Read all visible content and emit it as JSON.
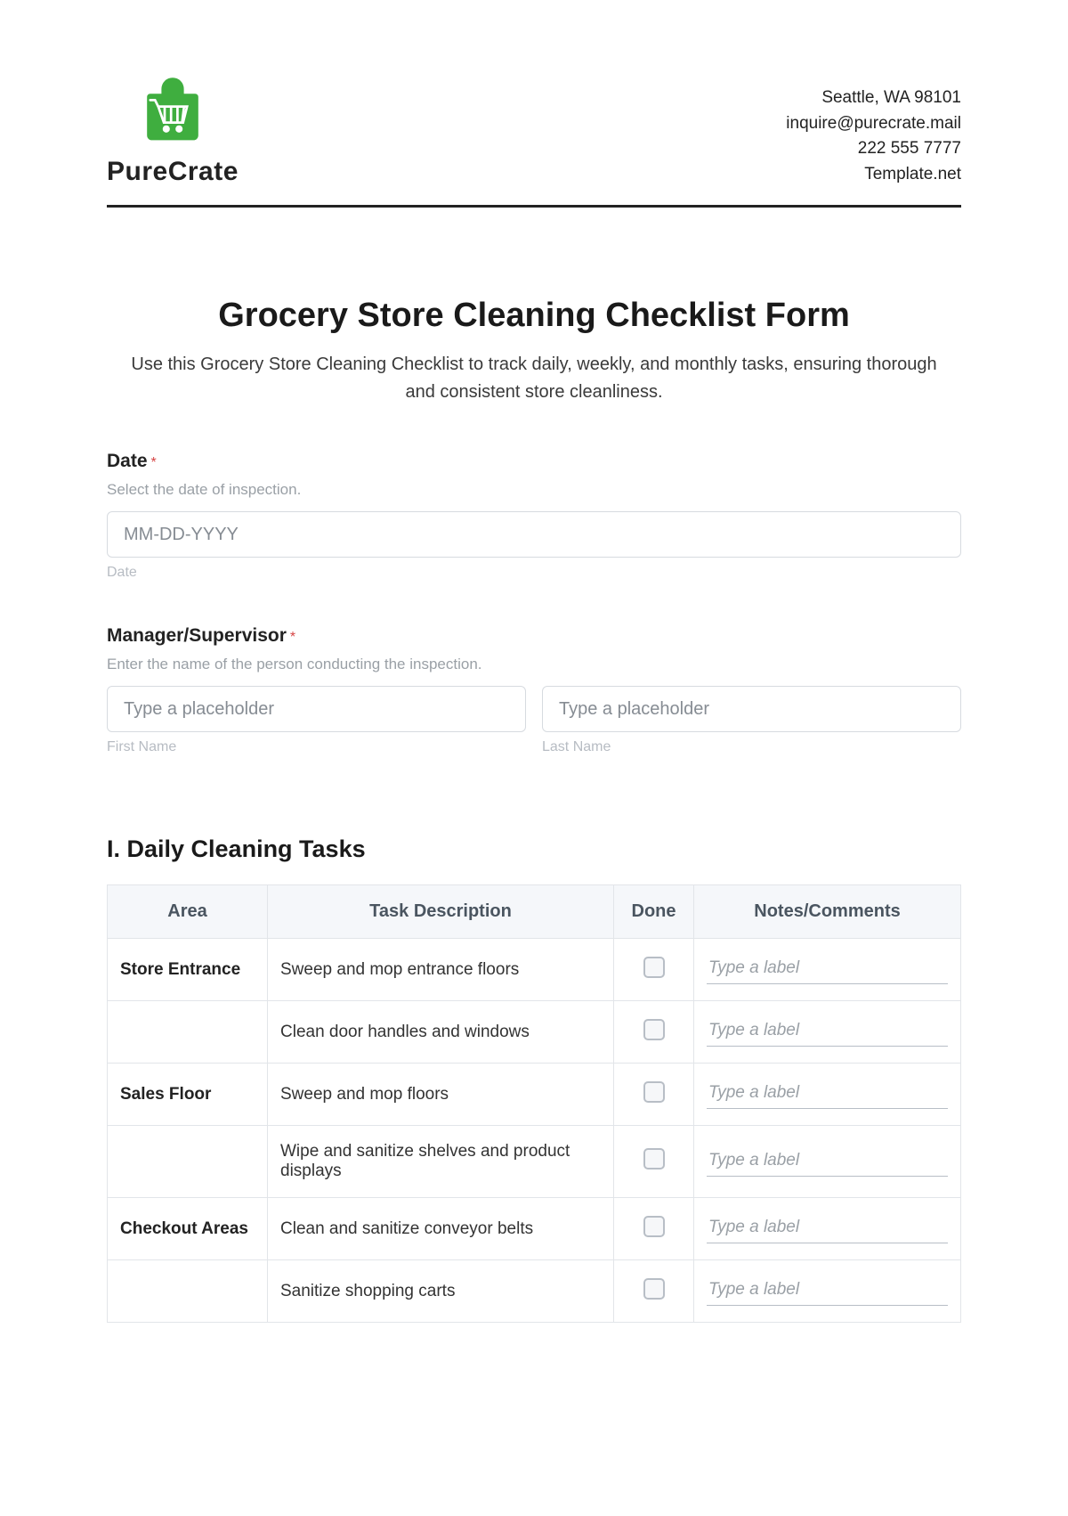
{
  "brand": {
    "name": "PureCrate"
  },
  "contact": {
    "line1": "Seattle, WA 98101",
    "line2": "inquire@purecrate.mail",
    "line3": "222 555 7777",
    "line4": "Template.net"
  },
  "title": "Grocery Store Cleaning Checklist Form",
  "subtitle": "Use this Grocery Store Cleaning Checklist to track daily, weekly, and monthly tasks, ensuring thorough and consistent store cleanliness.",
  "fields": {
    "date": {
      "label": "Date",
      "help": "Select the date of inspection.",
      "placeholder": "MM-DD-YYYY",
      "under": "Date"
    },
    "manager": {
      "label": "Manager/Supervisor",
      "help": "Enter the name of the person conducting the inspection.",
      "first_placeholder": "Type a placeholder",
      "last_placeholder": "Type a placeholder",
      "first_under": "First Name",
      "last_under": "Last Name"
    }
  },
  "section1": {
    "heading": "I. Daily Cleaning Tasks",
    "columns": {
      "area": "Area",
      "task": "Task Description",
      "done": "Done",
      "notes": "Notes/Comments"
    },
    "note_placeholder": "Type a label",
    "rows": [
      {
        "area": "Store Entrance",
        "task": "Sweep and mop entrance floors"
      },
      {
        "area": "",
        "task": "Clean door handles and windows"
      },
      {
        "area": "Sales Floor",
        "task": "Sweep and mop floors"
      },
      {
        "area": "",
        "task": "Wipe and sanitize shelves and product displays"
      },
      {
        "area": "Checkout Areas",
        "task": "Clean and sanitize conveyor belts"
      },
      {
        "area": "",
        "task": "Sanitize shopping carts"
      }
    ]
  }
}
